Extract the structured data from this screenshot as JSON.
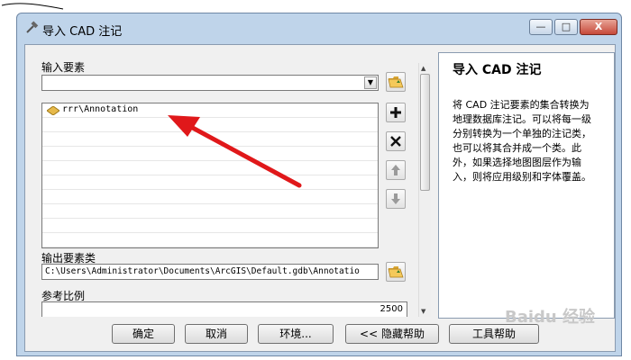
{
  "window": {
    "title": "导入 CAD 注记",
    "min_label": "—",
    "max_label": "□",
    "close_label": "X"
  },
  "form": {
    "input_label": "输入要素",
    "input_value": "",
    "list_items": [
      "rrr\\Annotation",
      "",
      "",
      "",
      "",
      "",
      "",
      "",
      "",
      ""
    ],
    "output_label": "输出要素类",
    "output_value": "C:\\Users\\Administrator\\Documents\\ArcGIS\\Default.gdb\\Annotatio",
    "scale_label": "参考比例",
    "scale_value": "2500"
  },
  "help": {
    "title": "导入 CAD 注记",
    "body": "将 CAD 注记要素的集合转换为地理数据库注记。可以将每一级分别转换为一个单独的注记类，也可以将其合并成一个类。此外，如果选择地图图层作为输入，则将应用级别和字体覆盖。"
  },
  "buttons": {
    "ok": "确定",
    "cancel": "取消",
    "env": "环境...",
    "hide_help": "<< 隐藏帮助",
    "tool_help": "工具帮助"
  },
  "colors": {
    "arrow": "#e0181a",
    "window_frame": "#bfd4ea"
  },
  "icons": {
    "title": "hammer-icon",
    "browse": "folder-open-icon",
    "add": "plus-icon",
    "remove": "x-icon",
    "up": "arrow-up-icon",
    "down": "arrow-down-icon"
  }
}
